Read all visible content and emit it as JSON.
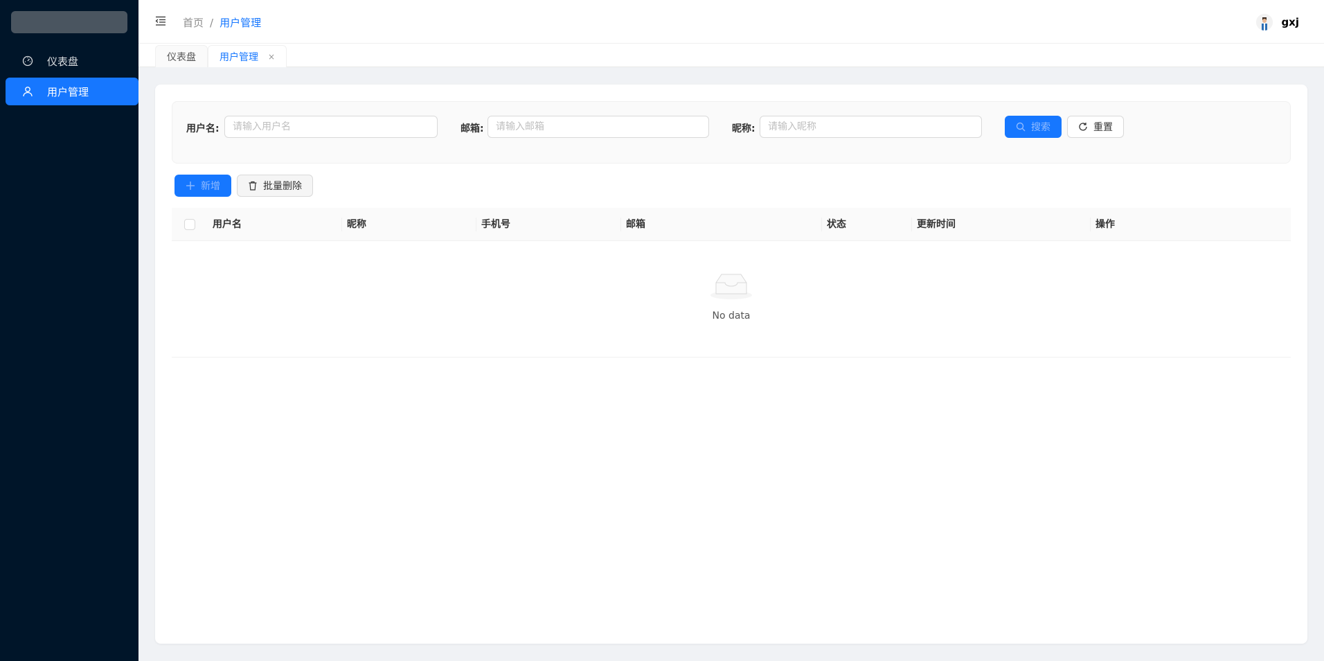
{
  "sidebar": {
    "items": [
      {
        "label": "仪表盘",
        "icon": "dashboard-icon",
        "active": false
      },
      {
        "label": "用户管理",
        "icon": "user-icon",
        "active": true
      }
    ]
  },
  "header": {
    "breadcrumb": {
      "home": "首页",
      "separator": "/",
      "current": "用户管理"
    },
    "user": {
      "name": "gxj"
    }
  },
  "tabs": [
    {
      "label": "仪表盘",
      "active": false
    },
    {
      "label": "用户管理",
      "active": true,
      "close": "×"
    }
  ],
  "search": {
    "username_label": "用户名:",
    "username_placeholder": "请输入用户名",
    "email_label": "邮箱:",
    "email_placeholder": "请输入邮箱",
    "nickname_label": "昵称:",
    "nickname_placeholder": "请输入昵称",
    "search_button": "搜索",
    "reset_button": "重置"
  },
  "toolbar": {
    "add_button": "新增",
    "batch_delete_button": "批量删除"
  },
  "table": {
    "columns": [
      "用户名",
      "昵称",
      "手机号",
      "邮箱",
      "状态",
      "更新时间",
      "操作"
    ],
    "empty_text": "No data"
  },
  "colors": {
    "primary": "#1677ff",
    "sidebar_bg": "#001529"
  }
}
